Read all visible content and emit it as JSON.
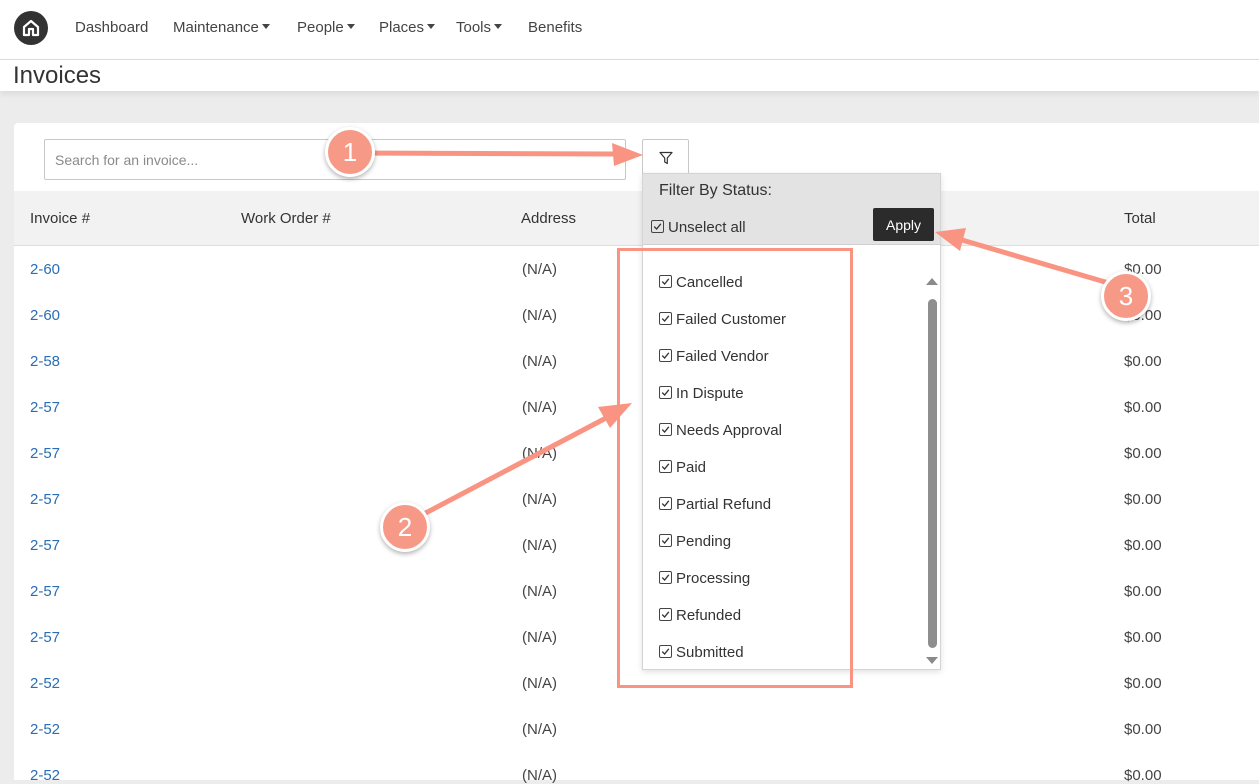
{
  "nav": {
    "items": [
      {
        "label": "Dashboard",
        "dropdown": false
      },
      {
        "label": "Maintenance",
        "dropdown": true
      },
      {
        "label": "People",
        "dropdown": true
      },
      {
        "label": "Places",
        "dropdown": true
      },
      {
        "label": "Tools",
        "dropdown": true
      },
      {
        "label": "Benefits",
        "dropdown": false
      }
    ]
  },
  "page": {
    "title": "Invoices"
  },
  "search": {
    "placeholder": "Search for an invoice..."
  },
  "table": {
    "headers": [
      "Invoice #",
      "Work Order #",
      "Address",
      "Total"
    ],
    "rows": [
      {
        "invoice": "2-60",
        "address": "(N/A)",
        "total": "$0.00"
      },
      {
        "invoice": "2-60",
        "address": "(N/A)",
        "total": "$0.00"
      },
      {
        "invoice": "2-58",
        "address": "(N/A)",
        "total": "$0.00"
      },
      {
        "invoice": "2-57",
        "address": "(N/A)",
        "total": "$0.00"
      },
      {
        "invoice": "2-57",
        "address": "(N/A)",
        "total": "$0.00"
      },
      {
        "invoice": "2-57",
        "address": "(N/A)",
        "total": "$0.00"
      },
      {
        "invoice": "2-57",
        "address": "(N/A)",
        "total": "$0.00"
      },
      {
        "invoice": "2-57",
        "address": "(N/A)",
        "total": "$0.00"
      },
      {
        "invoice": "2-57",
        "address": "(N/A)",
        "total": "$0.00"
      },
      {
        "invoice": "2-52",
        "address": "(N/A)",
        "total": "$0.00"
      },
      {
        "invoice": "2-52",
        "address": "(N/A)",
        "total": "$0.00"
      },
      {
        "invoice": "2-52",
        "address": "(N/A)",
        "total": "$0.00"
      }
    ]
  },
  "filter": {
    "title": "Filter By Status:",
    "unselect_all": "Unselect all",
    "apply": "Apply",
    "statuses": [
      {
        "label": "Cancelled",
        "checked": true
      },
      {
        "label": "Failed Customer",
        "checked": true
      },
      {
        "label": "Failed Vendor",
        "checked": true
      },
      {
        "label": "In Dispute",
        "checked": true
      },
      {
        "label": "Needs Approval",
        "checked": true
      },
      {
        "label": "Paid",
        "checked": true
      },
      {
        "label": "Partial Refund",
        "checked": true
      },
      {
        "label": "Pending",
        "checked": true
      },
      {
        "label": "Processing",
        "checked": true
      },
      {
        "label": "Refunded",
        "checked": true
      },
      {
        "label": "Submitted",
        "checked": true
      }
    ]
  },
  "annotations": {
    "callouts": [
      "1",
      "2",
      "3"
    ],
    "color": "#f79987"
  },
  "colors": {
    "link": "#2a6eb6",
    "apply_bg": "#2b2b2b",
    "annotation": "#fa9482"
  }
}
